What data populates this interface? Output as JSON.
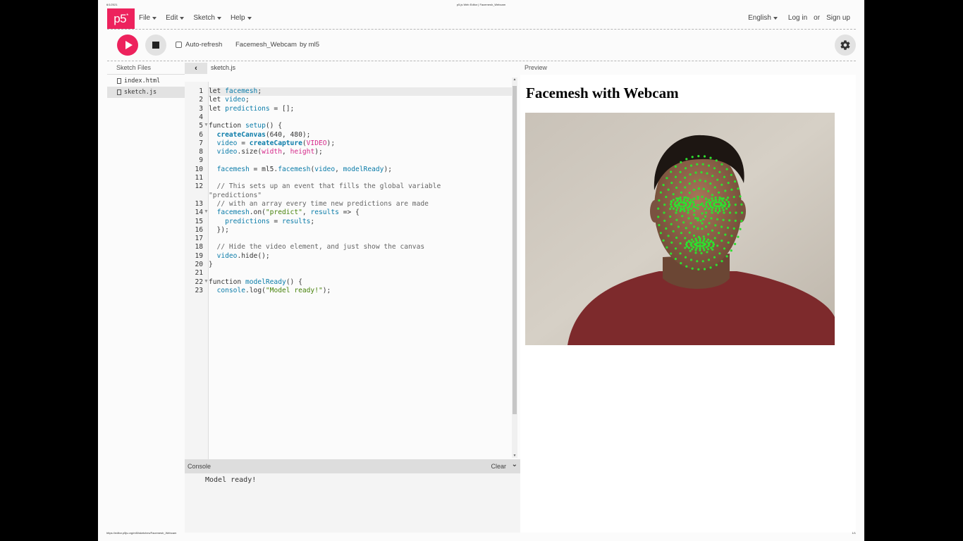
{
  "print": {
    "date": "6/1/2021",
    "title": "p5.js Web Editor | Facemesh_Webcam",
    "url": "https://editor.p5js.org/ml5/sketches/Facemesh_Webcam",
    "page": "1/1"
  },
  "nav": {
    "logo": "p5",
    "logo_mark": "*",
    "menu": [
      "File",
      "Edit",
      "Sketch",
      "Help"
    ],
    "language": "English",
    "login": "Log in",
    "or": "or",
    "signup": "Sign up"
  },
  "toolbar": {
    "auto_refresh_label": "Auto-refresh",
    "auto_refresh_checked": false,
    "sketch_name": "Facemesh_Webcam",
    "owner": "by ml5"
  },
  "sidebar": {
    "title": "Sketch Files",
    "files": [
      "index.html",
      "sketch.js"
    ],
    "active_file": "sketch.js"
  },
  "editor": {
    "tab": "sketch.js",
    "line_numbers": [
      "1",
      "2",
      "3",
      "4",
      "5",
      "6",
      "7",
      "8",
      "9",
      "10",
      "11",
      "12",
      "",
      "13",
      "14",
      "15",
      "16",
      "17",
      "18",
      "19",
      "20",
      "21",
      "22",
      "23"
    ],
    "lines": [
      "let facemesh;",
      "let video;",
      "let predictions = [];",
      "",
      "function setup() {",
      "  createCanvas(640, 480);",
      "  video = createCapture(VIDEO);",
      "  video.size(width, height);",
      "",
      "  facemesh = ml5.facemesh(video, modelReady);",
      "",
      "  // This sets up an event that fills the global variable",
      "\"predictions\"",
      "  // with an array every time new predictions are made",
      "  facemesh.on(\"predict\", results => {",
      "    predictions = results;",
      "  });",
      "",
      "  // Hide the video element, and just show the canvas",
      "  video.hide();",
      "}",
      "",
      "function modelReady() {",
      "  console.log(\"Model ready!\");"
    ]
  },
  "console": {
    "title": "Console",
    "clear": "Clear",
    "message": "Model ready!"
  },
  "preview": {
    "label": "Preview",
    "heading": "Facemesh with Webcam",
    "point_color": "#2ee02e"
  },
  "colors": {
    "accent": "#ed225d"
  }
}
